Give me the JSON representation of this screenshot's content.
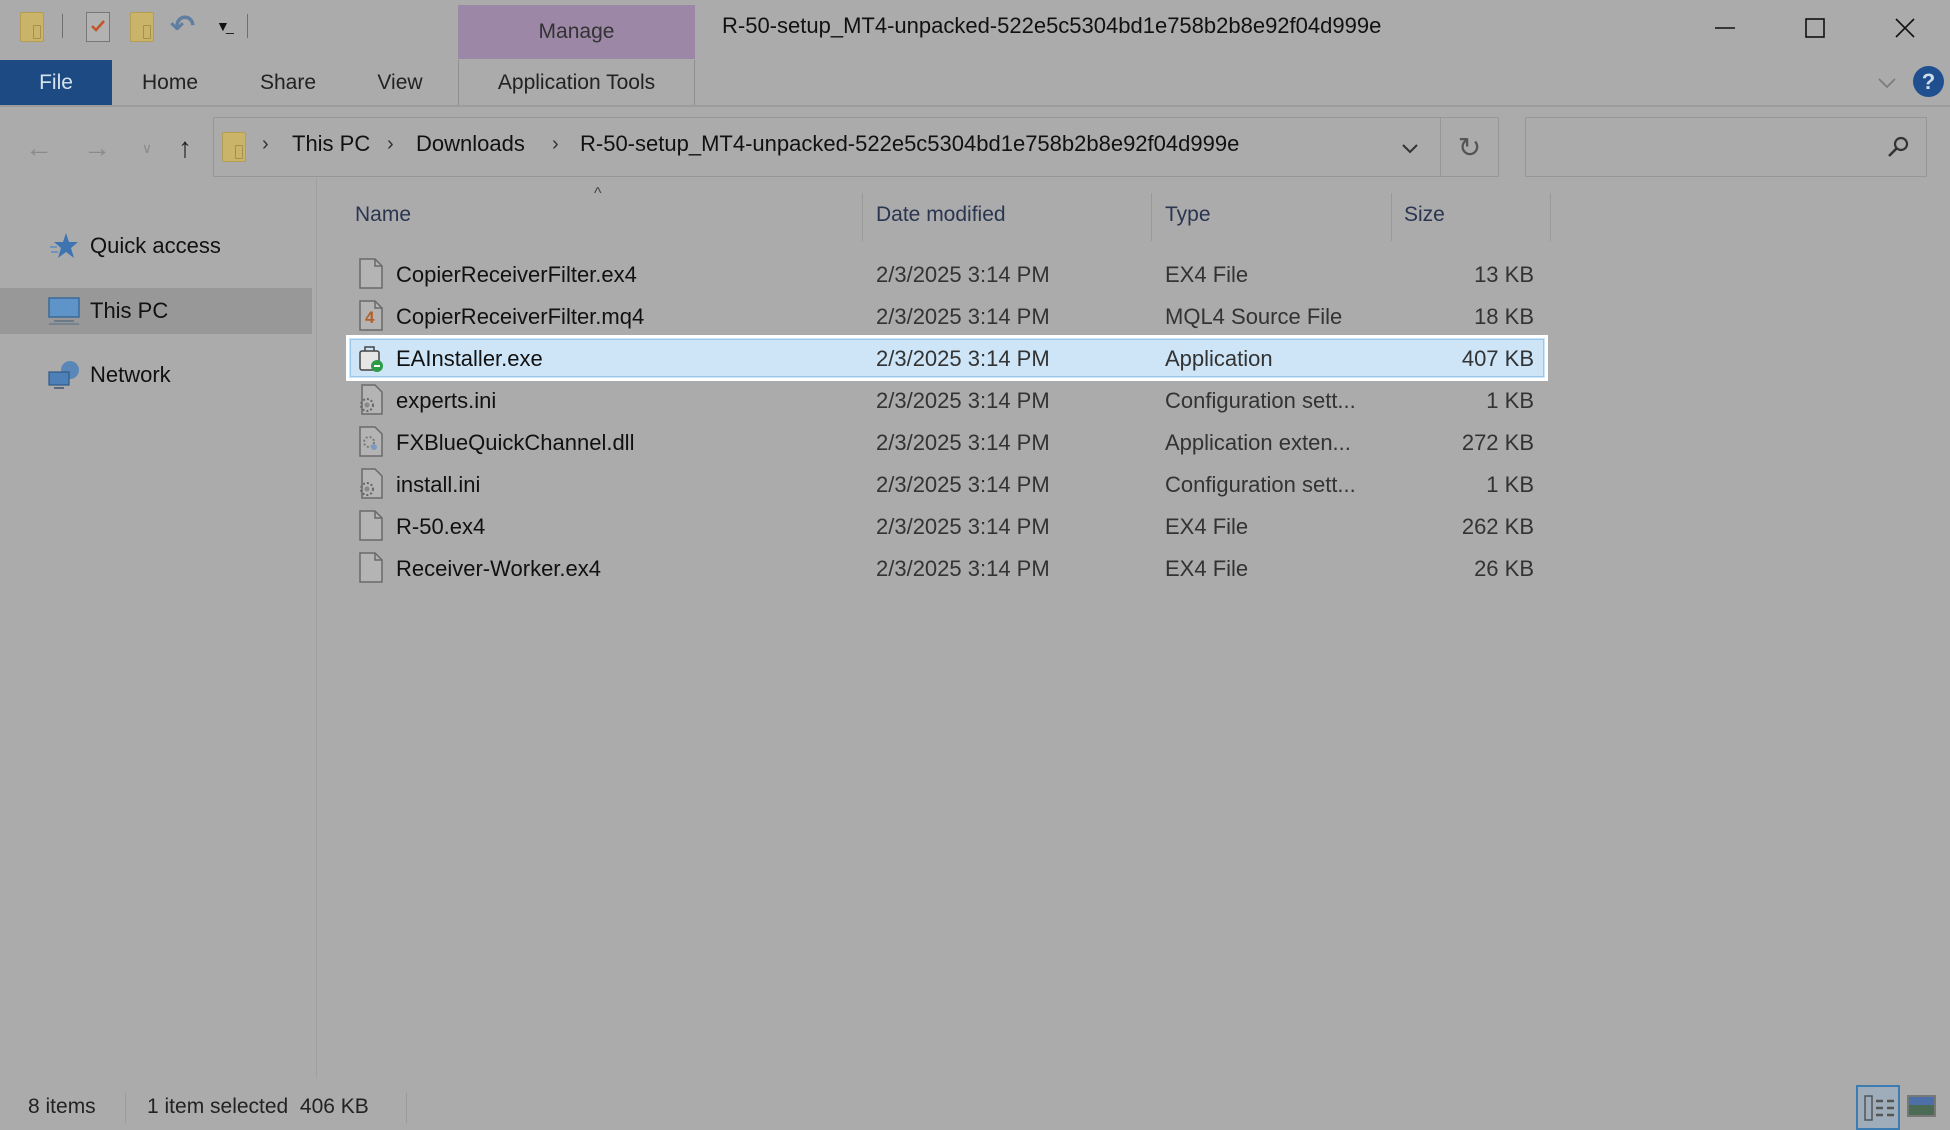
{
  "window": {
    "title": "R-50-setup_MT4-unpacked-522e5c5304bd1e758b2b8e92f04d999e",
    "contextual_tab_group": "Manage",
    "controls": {
      "minimize": "minimize-icon",
      "maximize": "maximize-icon",
      "close": "close-icon"
    }
  },
  "quick_access_toolbar": {
    "icons": [
      "folder-icon",
      "properties-icon",
      "new-folder-icon",
      "undo-icon",
      "customize-dropdown-icon"
    ]
  },
  "ribbon": {
    "tabs": [
      {
        "label": "File",
        "active": true
      },
      {
        "label": "Home"
      },
      {
        "label": "Share"
      },
      {
        "label": "View"
      },
      {
        "label": "Application Tools"
      }
    ],
    "help": "?"
  },
  "navigation": {
    "breadcrumb": [
      "This PC",
      "Downloads",
      "R-50-setup_MT4-unpacked-522e5c5304bd1e758b2b8e92f04d999e"
    ],
    "search_placeholder": ""
  },
  "sidebar": {
    "items": [
      {
        "label": "Quick access",
        "icon": "quick-access-star-icon"
      },
      {
        "label": "This PC",
        "icon": "computer-icon",
        "selected": true
      },
      {
        "label": "Network",
        "icon": "network-icon"
      }
    ]
  },
  "file_list": {
    "columns": [
      "Name",
      "Date modified",
      "Type",
      "Size"
    ],
    "sorted_by": "Name",
    "rows": [
      {
        "name": "CopierReceiverFilter.ex4",
        "date": "2/3/2025 3:14 PM",
        "type": "EX4 File",
        "size": "13 KB",
        "icon": "blank-file-icon"
      },
      {
        "name": "CopierReceiverFilter.mq4",
        "date": "2/3/2025 3:14 PM",
        "type": "MQL4 Source File",
        "size": "18 KB",
        "icon": "mql4-file-icon"
      },
      {
        "name": "EAInstaller.exe",
        "date": "2/3/2025 3:14 PM",
        "type": "Application",
        "size": "407 KB",
        "icon": "installer-app-icon",
        "selected": true
      },
      {
        "name": "experts.ini",
        "date": "2/3/2025 3:14 PM",
        "type": "Configuration sett...",
        "size": "1 KB",
        "icon": "config-file-icon"
      },
      {
        "name": "FXBlueQuickChannel.dll",
        "date": "2/3/2025 3:14 PM",
        "type": "Application exten...",
        "size": "272 KB",
        "icon": "dll-file-icon"
      },
      {
        "name": "install.ini",
        "date": "2/3/2025 3:14 PM",
        "type": "Configuration sett...",
        "size": "1 KB",
        "icon": "config-file-icon"
      },
      {
        "name": "R-50.ex4",
        "date": "2/3/2025 3:14 PM",
        "type": "EX4 File",
        "size": "262 KB",
        "icon": "blank-file-icon"
      },
      {
        "name": "Receiver-Worker.ex4",
        "date": "2/3/2025 3:14 PM",
        "type": "EX4 File",
        "size": "26 KB",
        "icon": "blank-file-icon"
      }
    ]
  },
  "status_bar": {
    "item_count": "8 items",
    "selection": "1 item selected  406 KB",
    "view": "details"
  },
  "colors": {
    "file_tab": "#1d4a82",
    "manage_tab": "#9c88a6",
    "selection": "#cde5f7",
    "background": "#ababab"
  }
}
